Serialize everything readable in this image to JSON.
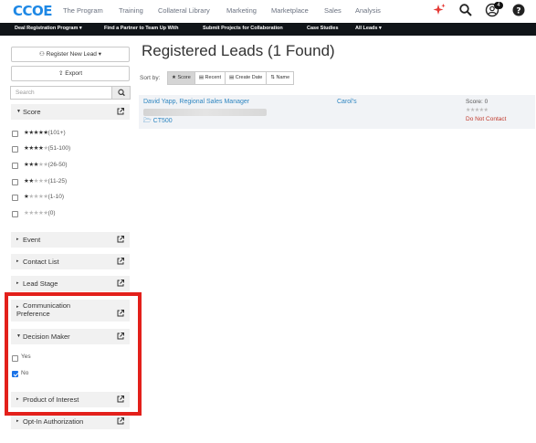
{
  "brand": {
    "logo_text": "CCOE"
  },
  "topnav": {
    "items": [
      "The Program",
      "Training",
      "Collateral Library",
      "Marketing",
      "Marketplace",
      "Sales",
      "Analysis"
    ],
    "notification_count": "4"
  },
  "subnav": {
    "items": [
      "Deal Registration Program ▾",
      "Find a Partner to Team Up With",
      "Submit Projects for Collaboration",
      "Case Studies",
      "All Leads ▾"
    ]
  },
  "sidebar": {
    "register_label": "Register New Lead ▾",
    "export_label": "Export",
    "search_placeholder": "Search",
    "score": {
      "title": "Score",
      "options": [
        {
          "stars": "★★★★★",
          "empty": "",
          "label": "(101+)"
        },
        {
          "stars": "★★★★",
          "empty": "★",
          "label": "(51-100)"
        },
        {
          "stars": "★★★",
          "empty": "★★",
          "label": "(26-50)"
        },
        {
          "stars": "★★",
          "empty": "★★★",
          "label": "(11-25)"
        },
        {
          "stars": "★",
          "empty": "★★★★",
          "label": "(1-10)"
        },
        {
          "stars": "",
          "empty": "★★★★★",
          "label": "(0)"
        }
      ]
    },
    "facets": {
      "event": "Event",
      "contact_list": "Contact List",
      "lead_stage": "Lead Stage",
      "communication_line1": "Communication",
      "communication_line2": "Preference",
      "decision_maker": "Decision Maker",
      "decision_yes": "Yes",
      "decision_no": "No",
      "product_interest": "Product of Interest",
      "opt_in": "Opt-In Authorization"
    },
    "decision_no_checked": true
  },
  "main": {
    "title": "Registered Leads",
    "found": "(1 Found)",
    "sort_label": "Sort by:",
    "sort_options": [
      "★ Score",
      "▤ Recent",
      "▤ Create Date",
      "⇅ Name"
    ],
    "active_sort": 0,
    "result": {
      "name": "David Yapp, Regional Sales Manager",
      "folder": "CT500",
      "company": "Carol's",
      "score": "Score: 0",
      "stars": "★★★★★",
      "status": "Do Not Contact"
    }
  },
  "colors": {
    "accent": "#2e86c1",
    "highlight": "#e3201b",
    "alert": "#c0392b",
    "subnav_bg": "#101418"
  }
}
